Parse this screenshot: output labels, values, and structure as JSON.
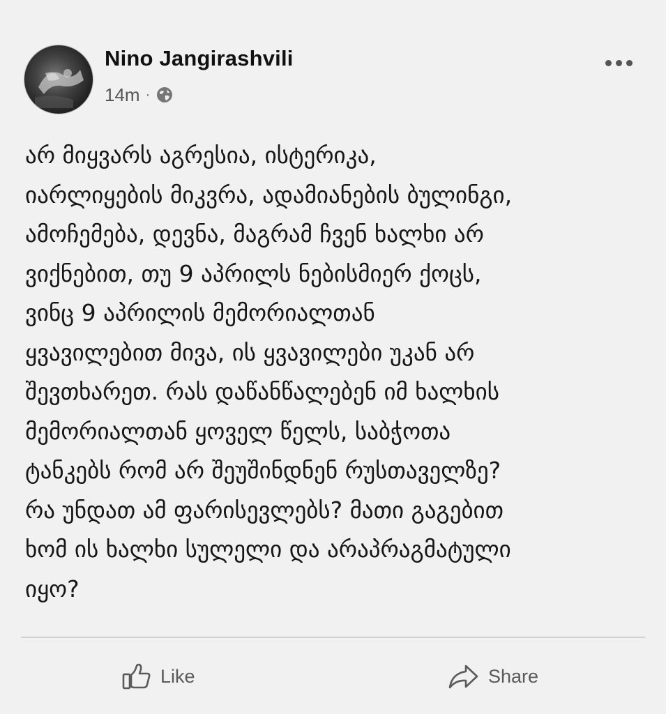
{
  "post": {
    "author": "Nino Jangirashvili",
    "timestamp": "14m",
    "separator": "·",
    "privacy_icon": "globe-icon",
    "menu_icon": "more-options-icon",
    "body_lines": [
      "არ მიყვარს აგრესია, ისტერიკა,",
      "იარლიყების მიკვრა, ადამიანების ბულინგი,",
      "ამოჩემება, დევნა, მაგრამ ჩვენ ხალხი არ",
      "ვიქნებით, თუ 9 აპრილს ნებისმიერ ქოცს,",
      "ვინც 9 აპრილის მემორიალთან",
      "ყვავილებით მივა, ის ყვავილები უკან არ",
      "შევთხარეთ. რას დაწანწალებენ იმ  ხალხის",
      "მემორიალთან ყოველ წელს, საბჭოთა",
      "ტანკებს რომ არ შეუშინდნენ რუსთაველზე?",
      "რა უნდათ ამ ფარისევლებს? მათი გაგებით",
      "ხომ ის ხალხი სულელი და არაპრაგმატული",
      "იყო?"
    ]
  },
  "actions": {
    "like_label": "Like",
    "like_icon": "thumbs-up-icon",
    "share_label": "Share",
    "share_icon": "share-arrow-icon"
  }
}
